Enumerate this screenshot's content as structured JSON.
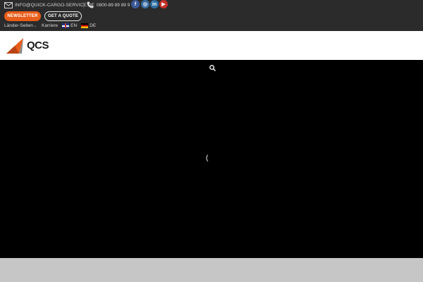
{
  "topbar": {
    "email": "INFO@QUICK-CARGO-SERVICE.DE",
    "phone": "0800-89 89 89 9",
    "social": {
      "facebook": "f",
      "instagram": "◎",
      "linkedin": "in",
      "youtube": "▶"
    },
    "newsletter_label": "NEWSLETTER",
    "quote_label": "GET A QUOTE",
    "nav": {
      "laender": "Länder-Seiten",
      "karriere": "Karriere"
    },
    "languages": [
      {
        "code": "EN"
      },
      {
        "code": "DE"
      }
    ]
  },
  "header": {
    "logo_text": "QCS"
  },
  "hero": {
    "loader": "("
  },
  "colors": {
    "accent": "#e85d1a",
    "topbar_bg": "#2b2b2b",
    "hero_bg": "#000000"
  }
}
